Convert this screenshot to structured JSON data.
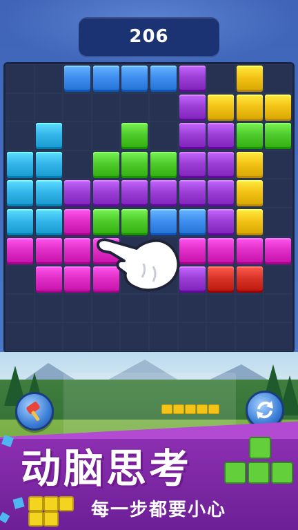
{
  "score": "206",
  "title": "动脑思考",
  "subtitle": "每一步都要小心",
  "colors": {
    "blue": "#3f8ef0",
    "purple": "#9b3fd6",
    "magenta": "#e02ec6",
    "yellow": "#f4c317",
    "green": "#4fcb2c",
    "cyan": "#35b6ea",
    "red": "#d93428"
  },
  "board": {
    "columns": 10,
    "rows": 10,
    "cells": [
      [
        null,
        null,
        "blue",
        "blue",
        "blue",
        "blue",
        "purple",
        null,
        "yellow",
        null
      ],
      [
        null,
        null,
        null,
        null,
        null,
        null,
        "purple",
        "yellow",
        "yellow",
        "yellow"
      ],
      [
        null,
        "cyan",
        null,
        null,
        "green",
        null,
        "purple",
        "purple",
        "green",
        "green"
      ],
      [
        "cyan",
        "cyan",
        null,
        "green",
        "green",
        "green",
        "purple",
        "purple",
        "yellow",
        null
      ],
      [
        "cyan",
        "cyan",
        "purple",
        "purple",
        "purple",
        "purple",
        "purple",
        "purple",
        "yellow",
        null
      ],
      [
        "cyan",
        "cyan",
        "magenta",
        "green",
        "green",
        "blue",
        "blue",
        "purple",
        "yellow",
        null
      ],
      [
        "magenta",
        "magenta",
        "magenta",
        "magenta",
        null,
        null,
        "magenta",
        "magenta",
        "magenta",
        "magenta"
      ],
      [
        null,
        "magenta",
        "magenta",
        "magenta",
        null,
        null,
        "purple",
        "red",
        "red",
        null
      ],
      [
        null,
        null,
        null,
        null,
        null,
        null,
        null,
        null,
        null,
        null
      ],
      [
        null,
        null,
        null,
        null,
        null,
        null,
        null,
        null,
        null,
        null
      ]
    ]
  },
  "buttons": {
    "left_icon": "hammer-icon",
    "right_icon": "refresh-icon"
  },
  "next_piece": {
    "color": "yellow",
    "length": 5
  }
}
